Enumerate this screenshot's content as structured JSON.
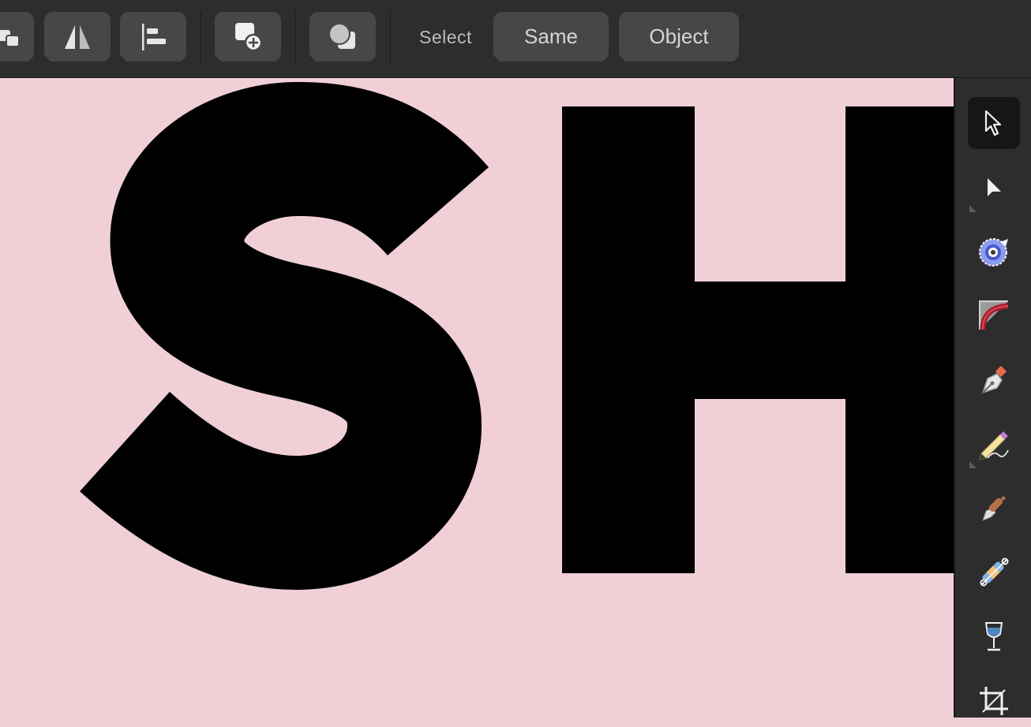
{
  "canvas": {
    "background_color": "#f1cfd7",
    "text": "SH",
    "text_color": "#000000"
  },
  "context_toolbar": {
    "buttons": [
      {
        "name": "arrange",
        "icon": "arrange-icon"
      },
      {
        "name": "flip-horizontal",
        "icon": "flip-horizontal-icon"
      },
      {
        "name": "align-left",
        "icon": "align-left-icon"
      },
      {
        "name": "add-shape",
        "icon": "add-shape-icon"
      },
      {
        "name": "boolean-operations",
        "icon": "boolean-icon"
      }
    ],
    "select_label": "Select",
    "select_same_label": "Same",
    "select_object_label": "Object"
  },
  "tools": [
    {
      "name": "move-tool",
      "icon": "move-pointer-icon",
      "active": true
    },
    {
      "name": "node-tool",
      "icon": "node-pointer-icon",
      "active": false
    },
    {
      "name": "transform-tool",
      "icon": "transform-target-icon",
      "active": false
    },
    {
      "name": "corner-tool",
      "icon": "corner-icon",
      "active": false
    },
    {
      "name": "pen-tool",
      "icon": "pen-nib-icon",
      "active": false
    },
    {
      "name": "pencil-tool",
      "icon": "pencil-icon",
      "active": false
    },
    {
      "name": "vector-brush-tool",
      "icon": "brush-icon",
      "active": false
    },
    {
      "name": "fill-tool",
      "icon": "gradient-fill-icon",
      "active": false
    },
    {
      "name": "transparency-tool",
      "icon": "wine-glass-icon",
      "active": false
    },
    {
      "name": "crop-tool",
      "icon": "crop-icon",
      "active": false
    }
  ]
}
